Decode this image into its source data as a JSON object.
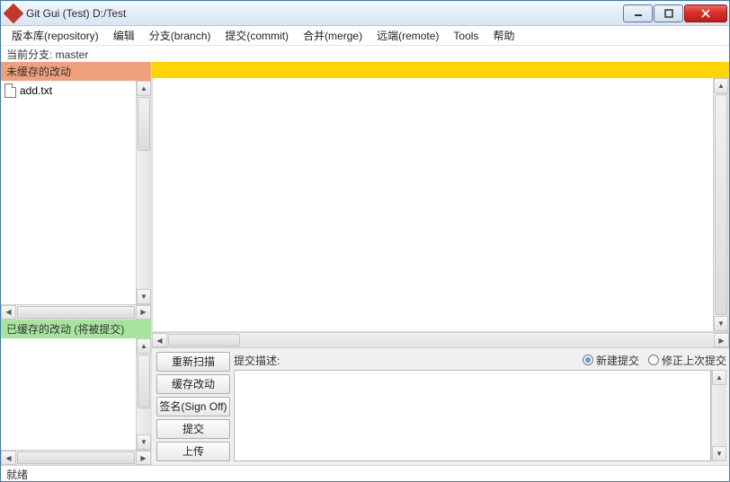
{
  "window": {
    "title": "Git Gui (Test) D:/Test"
  },
  "menu": {
    "repository": "版本库(repository)",
    "edit": "编辑",
    "branch": "分支(branch)",
    "commit": "提交(commit)",
    "merge": "合并(merge)",
    "remote": "远端(remote)",
    "tools": "Tools",
    "help": "帮助"
  },
  "branchbar": {
    "text": "当前分支: master"
  },
  "unstaged": {
    "header": "未缓存的改动",
    "files": [
      {
        "name": "add.txt"
      }
    ]
  },
  "staged": {
    "header": "已缓存的改动 (将被提交)",
    "files": []
  },
  "diff": {
    "header": ""
  },
  "commit": {
    "message_label": "提交描述:",
    "radio_new": "新建提交",
    "radio_amend": "修正上次提交",
    "selected": "new",
    "message": "",
    "buttons": {
      "rescan": "重新扫描",
      "stage": "缓存改动",
      "signoff": "签名(Sign Off)",
      "commit": "提交",
      "push": "上传"
    }
  },
  "status": {
    "text": "就绪"
  }
}
